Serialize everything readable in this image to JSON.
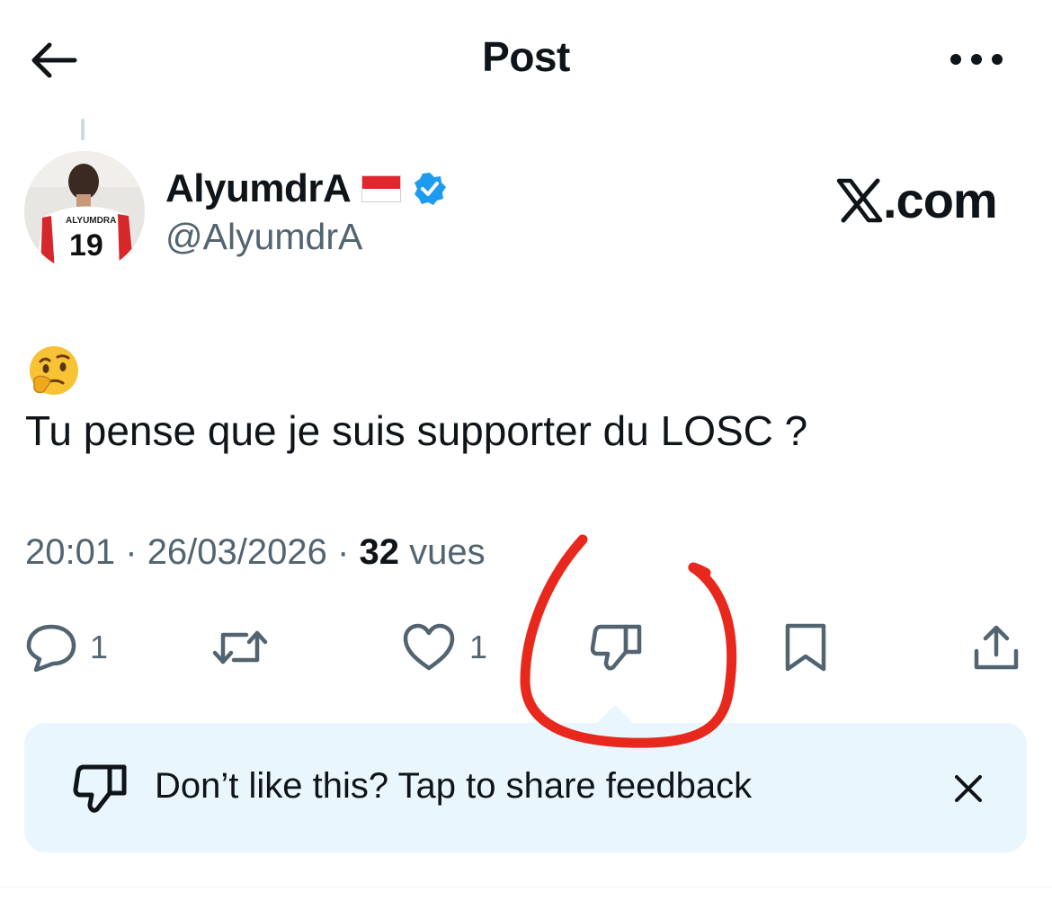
{
  "header": {
    "title": "Post",
    "back_icon": "arrow-left-icon",
    "more_icon": "more-horizontal-icon"
  },
  "author": {
    "display_name": "AlyumdrA",
    "handle": "@AlyumdrA",
    "flag": "Monaco/Indonesia flag (red over white)",
    "verified_color": "#1d9bf0",
    "avatar_jersey_name": "ALYUMDRA",
    "avatar_jersey_number": "19"
  },
  "brand": {
    "text": ".com",
    "logo": "X"
  },
  "post": {
    "emoji": "🤔",
    "text": "Tu pense que je suis supporter du LOSC ?",
    "time": "20:01",
    "date": "26/03/2026",
    "views_count": "32",
    "views_label": "vues",
    "separator": "·"
  },
  "actions": {
    "reply_count": "1",
    "repost_count": "",
    "like_count": "1"
  },
  "feedback_banner": {
    "text": "Don’t like this? Tap to share feedback",
    "background": "#eaf6fd"
  },
  "annotation": {
    "color": "#e8281c",
    "shape": "hand-drawn circle around dislike button"
  },
  "colors": {
    "text": "#0f1419",
    "secondary": "#536471",
    "accent": "#1d9bf0"
  }
}
